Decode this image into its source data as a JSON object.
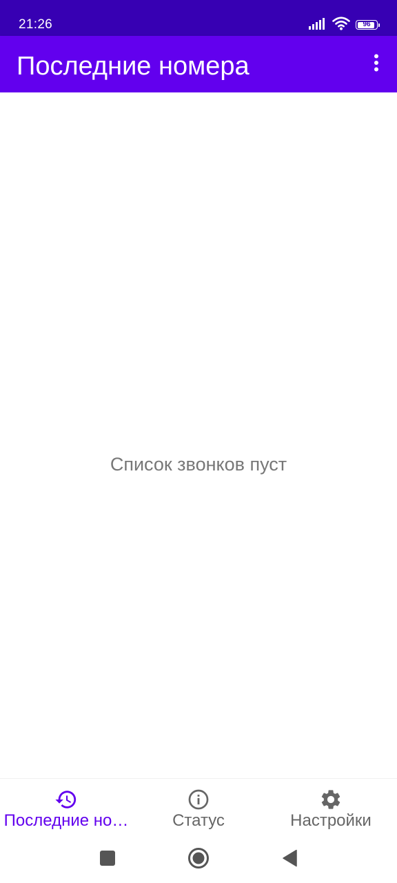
{
  "status_bar": {
    "time": "21:26",
    "battery_level": "96",
    "battery_fraction": 0.96,
    "icons": [
      "signal-icon",
      "wifi-icon",
      "battery-icon"
    ]
  },
  "app_bar": {
    "title": "Последние номера",
    "menu_icon": "more-vert-icon"
  },
  "main": {
    "empty_message": "Список звонков пуст"
  },
  "bottom_nav": {
    "items": [
      {
        "label": "Последние но…",
        "icon": "history-icon",
        "active": true
      },
      {
        "label": "Статус",
        "icon": "info-icon",
        "active": false
      },
      {
        "label": "Настройки",
        "icon": "settings-icon",
        "active": false
      }
    ]
  },
  "system_nav": {
    "buttons": [
      "recents-square-icon",
      "home-circle-icon",
      "back-triangle-icon"
    ]
  },
  "colors": {
    "status_bar": "#3700b3",
    "app_bar": "#6200ee",
    "accent": "#6200ee",
    "inactive": "#666666",
    "empty_text": "#777777",
    "system_icons": "#555555"
  }
}
